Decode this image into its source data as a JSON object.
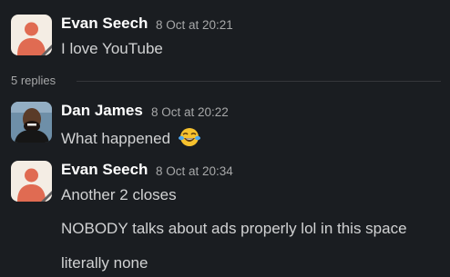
{
  "messages": [
    {
      "author": "Evan Seech",
      "time": "8 Oct at 20:21",
      "lines": [
        "I love YouTube"
      ],
      "avatar": "default-avatar-icon"
    },
    {
      "author": "Dan James",
      "time": "8 Oct at 20:22",
      "lines": [
        "What happened"
      ],
      "avatar": "user-photo",
      "emoji": "tears-of-joy-emoji"
    },
    {
      "author": "Evan Seech",
      "time": "8 Oct at 20:34",
      "lines": [
        "Another 2 closes",
        "NOBODY talks about ads properly lol in this space",
        "literally none"
      ],
      "avatar": "default-avatar-icon"
    }
  ],
  "thread": {
    "replies_label": "5 replies"
  },
  "colors": {
    "background": "#1a1d21",
    "avatar_bg": "#f4ede4",
    "avatar_accent": "#e06b52"
  }
}
